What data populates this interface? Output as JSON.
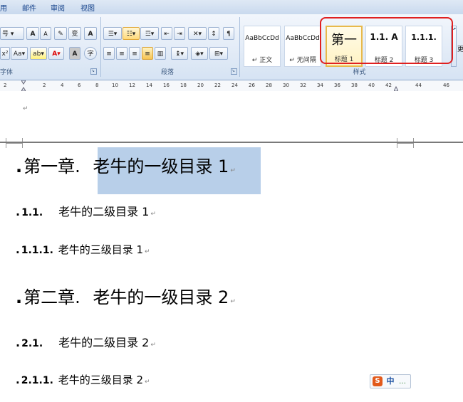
{
  "tabs": [
    "用",
    "邮件",
    "审阅",
    "视图"
  ],
  "font_group": {
    "font_size_label": "号",
    "grow_label": "A",
    "shrink_label": "A",
    "change_case_label": "Aa",
    "char_style_label": "变",
    "border_label": "A",
    "highlight_label": "ab",
    "font_color_label": "A",
    "shading_label": "A",
    "enclose_label": "字",
    "group_label": "字体"
  },
  "paragraph_group": {
    "group_label": "段落"
  },
  "styles_group": {
    "group_label": "样式",
    "styles": [
      {
        "sample": "AaBbCcDd",
        "name": "↵ 正文",
        "selected": false
      },
      {
        "sample": "AaBbCcDd",
        "name": "↵ 无间隔",
        "selected": false
      },
      {
        "sample": "第一",
        "name": "标题 1",
        "selected": true
      },
      {
        "sample": "1.1. A",
        "name": "标题 2",
        "selected": false
      },
      {
        "sample": "1.1.1.",
        "name": "标题 3",
        "selected": false
      }
    ],
    "more_label": "更"
  },
  "ruler": {
    "ticks": [
      "2",
      "2",
      "4",
      "6",
      "8",
      "10",
      "12",
      "14",
      "16",
      "18",
      "20",
      "22",
      "24",
      "26",
      "28",
      "30",
      "32",
      "34",
      "36",
      "38",
      "40",
      "42",
      "44",
      "46"
    ]
  },
  "document": {
    "paragraph_mark": "↵",
    "headings": [
      {
        "level": 1,
        "number": "第一章.",
        "text": "老牛的一级目录 1"
      },
      {
        "level": 2,
        "number": "1.1.",
        "text": "老牛的二级目录 1"
      },
      {
        "level": 3,
        "number": "1.1.1.",
        "text": "老牛的三级目录 1"
      },
      {
        "level": 1,
        "number": "第二章.",
        "text": "老牛的一级目录 2"
      },
      {
        "level": 2,
        "number": "2.1.",
        "text": "老牛的二级目录 2"
      },
      {
        "level": 3,
        "number": "2.1.1.",
        "text": "老牛的三级目录 2"
      }
    ]
  },
  "ime": {
    "logo": "S",
    "mode": "中",
    "punct": "…"
  },
  "colors": {
    "highlight_bg": "#b8cfe9",
    "annotation_ring": "#e02020",
    "selected_style": "#e8b94b"
  }
}
